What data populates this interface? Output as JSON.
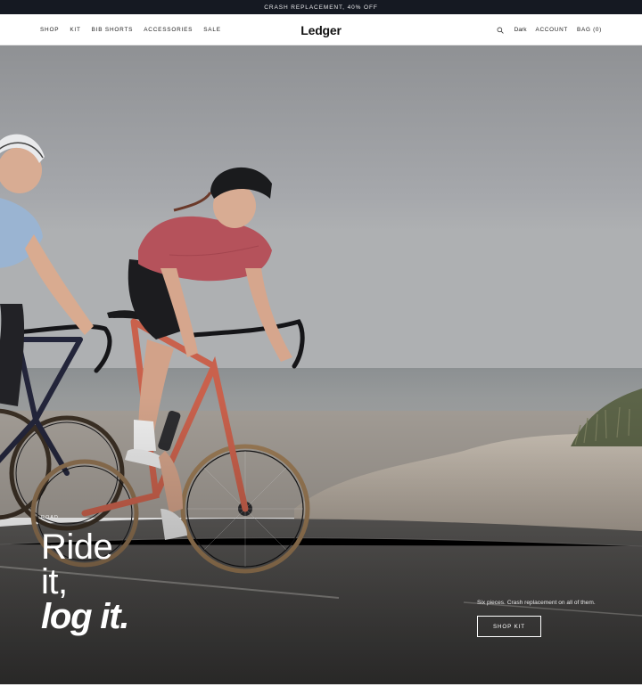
{
  "promo": {
    "text": "CRASH REPLACEMENT, 40% OFF"
  },
  "header": {
    "nav": [
      {
        "label": "SHOP"
      },
      {
        "label": "KIT"
      },
      {
        "label": "BIB SHORTS"
      },
      {
        "label": "ACCESSORIES"
      },
      {
        "label": "SALE"
      }
    ],
    "logo": "Ledger",
    "search_icon": "search-icon",
    "theme_toggle": "Dark",
    "account": "ACCOUNT",
    "bag": "BAG (0)"
  },
  "hero": {
    "eyebrow": "ROAD",
    "title_line1": "Ride",
    "title_line2": "it,",
    "title_line3": "log it.",
    "subtext": "Six pieces. Crash replacement on all of them.",
    "cta": "SHOP KIT"
  },
  "colors": {
    "promo_bg": "#151922",
    "header_bg": "#ffffff",
    "text_dark": "#111111",
    "sky": "#a9abaf",
    "road": "#4b4a49",
    "sand": "#bfb6aa",
    "jersey_rider": "#b5525b",
    "bike_frame": "#c9614c"
  }
}
